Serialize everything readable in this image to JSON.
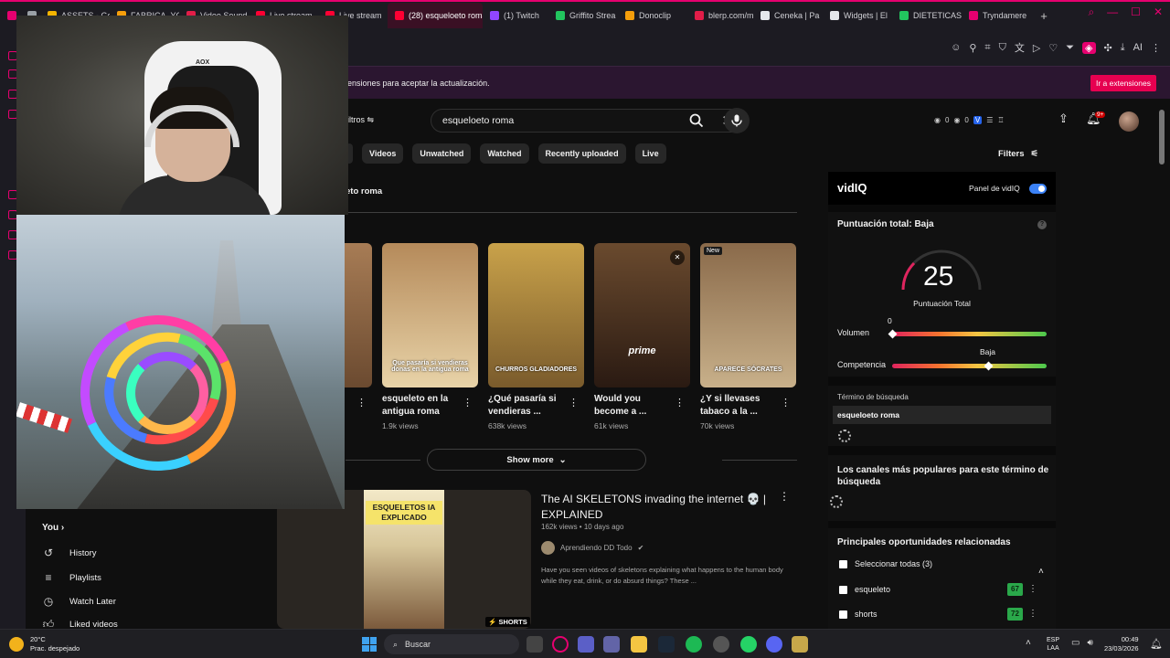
{
  "browser": {
    "tabs": [
      {
        "label": "",
        "color": "#e6006f"
      },
      {
        "label": "",
        "color": "#9aa0a6"
      },
      {
        "label": "ASSETS - Go",
        "color": "#f4b400"
      },
      {
        "label": "FABRICA_YO",
        "color": "#f59e0b"
      },
      {
        "label": "Video Sound",
        "color": "#e11d48"
      },
      {
        "label": "Live stream",
        "color": "#ff0033"
      },
      {
        "label": "Live stream",
        "color": "#ff0033"
      },
      {
        "label": "(28) esqueloeto roma",
        "color": "#ff0033",
        "active": true
      },
      {
        "label": "(1) Twitch",
        "color": "#9146ff"
      },
      {
        "label": "Griffito Strea",
        "color": "#22c55e"
      },
      {
        "label": "Donoclip",
        "color": "#f59e0b"
      },
      {
        "label": "blerp.com/m",
        "color": "#e11d48"
      },
      {
        "label": "Ceneka | Pa",
        "color": "#e5e7eb"
      },
      {
        "label": "Widgets | El",
        "color": "#e5e7eb"
      },
      {
        "label": "DIETETICAS",
        "color": "#22c55e"
      },
      {
        "label": "Tryndamere",
        "color": "#e6006f"
      }
    ],
    "new_tab": "+",
    "notification": {
      "message": "ensiones para aceptar la actualización.",
      "button": "Ir a extensiones"
    },
    "toolbar_ai": "AI"
  },
  "youtube": {
    "filters_label": "iltros",
    "search": {
      "value": "esqueloeto roma",
      "clear": "✕"
    },
    "vidiq_header_stats": {
      "views_a": "0",
      "views_b": "0"
    },
    "notif_count": "9+",
    "chips": [
      "Videos",
      "Unwatched",
      "Watched",
      "Recently uploaded",
      "Live"
    ],
    "filters_right": "Filters",
    "section_title": "eto roma",
    "shorts": [
      {
        "title": "esqueleto en la antigua roma",
        "views": "1.9k views",
        "overlay": "Que pasaría si vendieras donas en la antigua roma",
        "colors": [
          "#b58a5a",
          "#e8d3a8"
        ]
      },
      {
        "title": "¿Qué pasaría si vendieras ...",
        "views": "638k views",
        "overlay": "CHURROS GLADIADORES",
        "colors": [
          "#c9a24a",
          "#7a5b2c"
        ]
      },
      {
        "title": "Would you become a ...",
        "views": "61k views",
        "overlay": "prime",
        "colors": [
          "#6a4a2e",
          "#2a1a12"
        ]
      },
      {
        "title": "¿Y si llevases tabaco a la ...",
        "views": "70k views",
        "overlay": "APARECE SÓCRATES",
        "badge": "New",
        "colors": [
          "#8a6a4a",
          "#c8b08a"
        ]
      }
    ],
    "show_more": "Show more",
    "video": {
      "title": "The AI SKELETONS invading the internet 💀 | EXPLAINED",
      "meta": "162k views • 10 days ago",
      "channel": "Aprendiendo DD Todo",
      "description": "Have you seen videos of skeletons explaining what happens to the human body while they eat, drink, or do absurd things? These ...",
      "thumb_text": "ESQUELETOS IA EXPLICADO",
      "shorts_badge": "SHORTS"
    },
    "you_section": {
      "title": "You",
      "items": [
        "History",
        "Playlists",
        "Watch Later",
        "Liked videos"
      ]
    }
  },
  "vidiq": {
    "logo": "vidIQ",
    "panel_label": "Panel de vidIQ",
    "score_title": "Puntuación total: Baja",
    "score": "25",
    "score_sub": "Puntuación Total",
    "volume_label": "Volumen",
    "volume_value": "0",
    "volume_level": 0,
    "competition_label": "Competencia",
    "competition_value": "Baja",
    "competition_level": 0.62,
    "term_label": "Término de búsqueda",
    "term_value": "esqueloeto roma",
    "channels_title": "Los canales más populares para este término de búsqueda",
    "opps_title": "Principales oportunidades relacionadas",
    "select_all": "Seleccionar todas (3)",
    "keywords": [
      {
        "name": "esqueleto",
        "score": "67"
      },
      {
        "name": "shorts",
        "score": "72"
      }
    ]
  },
  "webcam": {
    "chair_label": "AOX"
  },
  "taskbar": {
    "temp": "20°C",
    "weather": "Prac. despejado",
    "search": "Buscar",
    "lang": "ESP",
    "lang2": "LAA",
    "time": "00:49",
    "date": "23/03/2026"
  }
}
